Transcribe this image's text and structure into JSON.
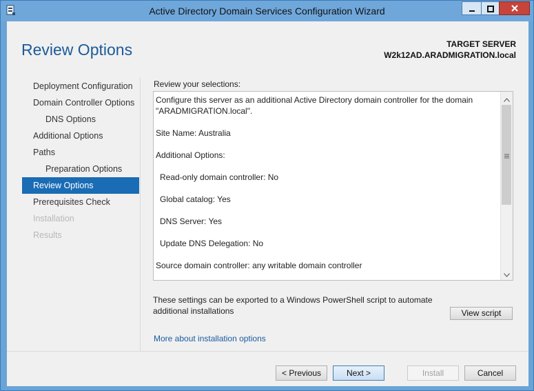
{
  "window": {
    "title": "Active Directory Domain Services Configuration Wizard",
    "icons": [
      "server-manager-icon",
      "minimize-icon",
      "maximize-icon",
      "close-icon"
    ]
  },
  "header": {
    "page_title": "Review Options",
    "target_label": "TARGET SERVER",
    "target_value": "W2k12AD.ARADMIGRATION.local"
  },
  "nav": {
    "items": [
      {
        "label": "Deployment Configuration"
      },
      {
        "label": "Domain Controller Options"
      },
      {
        "label": "DNS Options"
      },
      {
        "label": "Additional Options"
      },
      {
        "label": "Paths"
      },
      {
        "label": "Preparation Options"
      },
      {
        "label": "Review Options"
      },
      {
        "label": "Prerequisites Check"
      },
      {
        "label": "Installation"
      },
      {
        "label": "Results"
      }
    ]
  },
  "review": {
    "label": "Review your selections:",
    "lines": [
      "Configure this server as an additional Active Directory domain controller for the domain",
      "\"ARADMIGRATION.local\".",
      "Site Name: Australia",
      "Additional Options:",
      "Read-only domain controller: No",
      "Global catalog: Yes",
      "DNS Server: Yes",
      "Update DNS Delegation: No",
      "Source domain controller: any writable domain controller"
    ]
  },
  "export": {
    "text": "These settings can be exported to a Windows PowerShell script to automate additional installations",
    "view_script": "View script"
  },
  "more_link": "More about installation options",
  "footer": {
    "previous": "< Previous",
    "next": "Next >",
    "install": "Install",
    "cancel": "Cancel"
  },
  "colors": {
    "accent": "#1a6cb5",
    "title_blue": "#1c5a9a",
    "frame": "#6fa7db",
    "close": "#c7443a"
  }
}
